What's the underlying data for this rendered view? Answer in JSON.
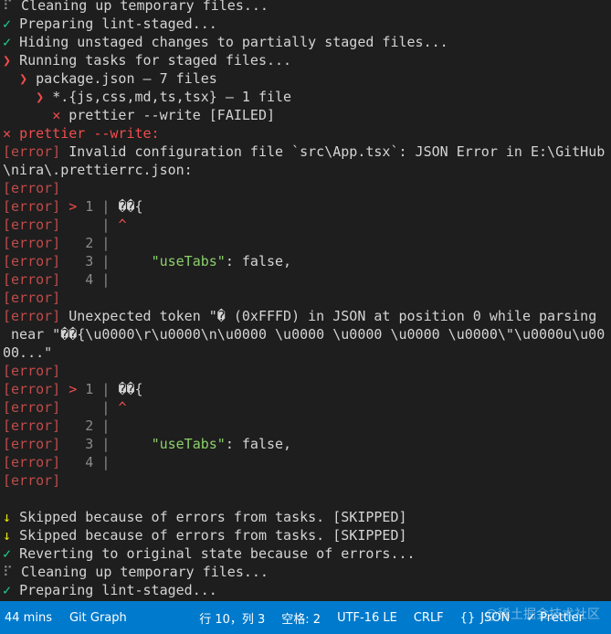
{
  "terminal": {
    "lines": [
      [
        {
          "t": "⠏ ",
          "c": "c-dim"
        },
        {
          "t": "Cleaning up temporary files..."
        }
      ],
      [
        {
          "t": "✓ ",
          "c": "c-green"
        },
        {
          "t": "Preparing lint-staged..."
        }
      ],
      [
        {
          "t": "✓ ",
          "c": "c-green"
        },
        {
          "t": "Hiding unstaged changes to partially staged files..."
        }
      ],
      [
        {
          "t": "❯ ",
          "c": "c-red"
        },
        {
          "t": "Running tasks for staged files..."
        }
      ],
      [
        {
          "t": "  "
        },
        {
          "t": "❯ ",
          "c": "c-red"
        },
        {
          "t": "package.json — 7 files"
        }
      ],
      [
        {
          "t": "    "
        },
        {
          "t": "❯ ",
          "c": "c-red"
        },
        {
          "t": "*.{js,css,md,ts,tsx} — 1 file"
        }
      ],
      [
        {
          "t": "      "
        },
        {
          "t": "✕ ",
          "c": "c-red"
        },
        {
          "t": "prettier --write [FAILED]"
        }
      ],
      [
        {
          "t": "✕ ",
          "c": "c-red"
        },
        {
          "t": "prettier --write:",
          "c": "c-red"
        }
      ],
      [
        {
          "t": "[error]",
          "c": "c-err"
        },
        {
          "t": " Invalid configuration file `src\\App.tsx`: JSON Error in E:\\GitHub"
        }
      ],
      [
        {
          "t": "\\nira\\.prettierrc.json:"
        }
      ],
      [
        {
          "t": "[error]",
          "c": "c-err"
        }
      ],
      [
        {
          "t": "[error]",
          "c": "c-err"
        },
        {
          "t": " "
        },
        {
          "t": ">",
          "c": "c-red"
        },
        {
          "t": " 1 | ",
          "c": "c-dim"
        },
        {
          "t": "��{"
        }
      ],
      [
        {
          "t": "[error]",
          "c": "c-err"
        },
        {
          "t": "     | ",
          "c": "c-dim"
        },
        {
          "t": "^",
          "c": "c-red"
        }
      ],
      [
        {
          "t": "[error]",
          "c": "c-err"
        },
        {
          "t": "   2 |",
          "c": "c-dim"
        }
      ],
      [
        {
          "t": "[error]",
          "c": "c-err"
        },
        {
          "t": "   3 |",
          "c": "c-dim"
        },
        {
          "t": "     "
        },
        {
          "t": "\"useTabs\"",
          "c": "c-jsonkey"
        },
        {
          "t": ": false,"
        }
      ],
      [
        {
          "t": "[error]",
          "c": "c-err"
        },
        {
          "t": "   4 |",
          "c": "c-dim"
        }
      ],
      [
        {
          "t": "[error]",
          "c": "c-err"
        }
      ],
      [
        {
          "t": "[error]",
          "c": "c-err"
        },
        {
          "t": " Unexpected token \"� (0xFFFD) in JSON at position 0 while parsing"
        }
      ],
      [
        {
          "t": " near \"��{\\u0000\\r\\u0000\\n\\u0000 \\u0000 \\u0000 \\u0000 \\u0000\\\"\\u0000u\\u00"
        }
      ],
      [
        {
          "t": "00...\""
        }
      ],
      [
        {
          "t": "[error]",
          "c": "c-err"
        }
      ],
      [
        {
          "t": "[error]",
          "c": "c-err"
        },
        {
          "t": " "
        },
        {
          "t": ">",
          "c": "c-red"
        },
        {
          "t": " 1 | ",
          "c": "c-dim"
        },
        {
          "t": "��{"
        }
      ],
      [
        {
          "t": "[error]",
          "c": "c-err"
        },
        {
          "t": "     | ",
          "c": "c-dim"
        },
        {
          "t": "^",
          "c": "c-red"
        }
      ],
      [
        {
          "t": "[error]",
          "c": "c-err"
        },
        {
          "t": "   2 |",
          "c": "c-dim"
        }
      ],
      [
        {
          "t": "[error]",
          "c": "c-err"
        },
        {
          "t": "   3 |",
          "c": "c-dim"
        },
        {
          "t": "     "
        },
        {
          "t": "\"useTabs\"",
          "c": "c-jsonkey"
        },
        {
          "t": ": false,"
        }
      ],
      [
        {
          "t": "[error]",
          "c": "c-err"
        },
        {
          "t": "   4 |",
          "c": "c-dim"
        }
      ],
      [
        {
          "t": "[error]",
          "c": "c-err"
        }
      ],
      [],
      [
        {
          "t": "↓ ",
          "c": "c-yellow"
        },
        {
          "t": "Skipped because of errors from tasks. [SKIPPED]"
        }
      ],
      [
        {
          "t": "↓ ",
          "c": "c-yellow"
        },
        {
          "t": "Skipped because of errors from tasks. [SKIPPED]"
        }
      ],
      [
        {
          "t": "✓ ",
          "c": "c-green"
        },
        {
          "t": "Reverting to original state because of errors..."
        }
      ],
      [
        {
          "t": "⠏ ",
          "c": "c-dim"
        },
        {
          "t": "Cleaning up temporary files..."
        }
      ],
      [
        {
          "t": "✓ ",
          "c": "c-green"
        },
        {
          "t": "Preparing lint-staged..."
        }
      ]
    ]
  },
  "statusbar": {
    "time": "44 mins",
    "git_graph": "Git Graph",
    "position": "行 10，列 3",
    "spaces": "空格: 2",
    "encoding": "UTF-16 LE",
    "eol": "CRLF",
    "language": "JSON",
    "prettier": "Prettier",
    "watermark": "@稀土掘金技术社区",
    "colors": {
      "bar": "#007acc",
      "terminal_bg": "#1e1e1e"
    }
  }
}
